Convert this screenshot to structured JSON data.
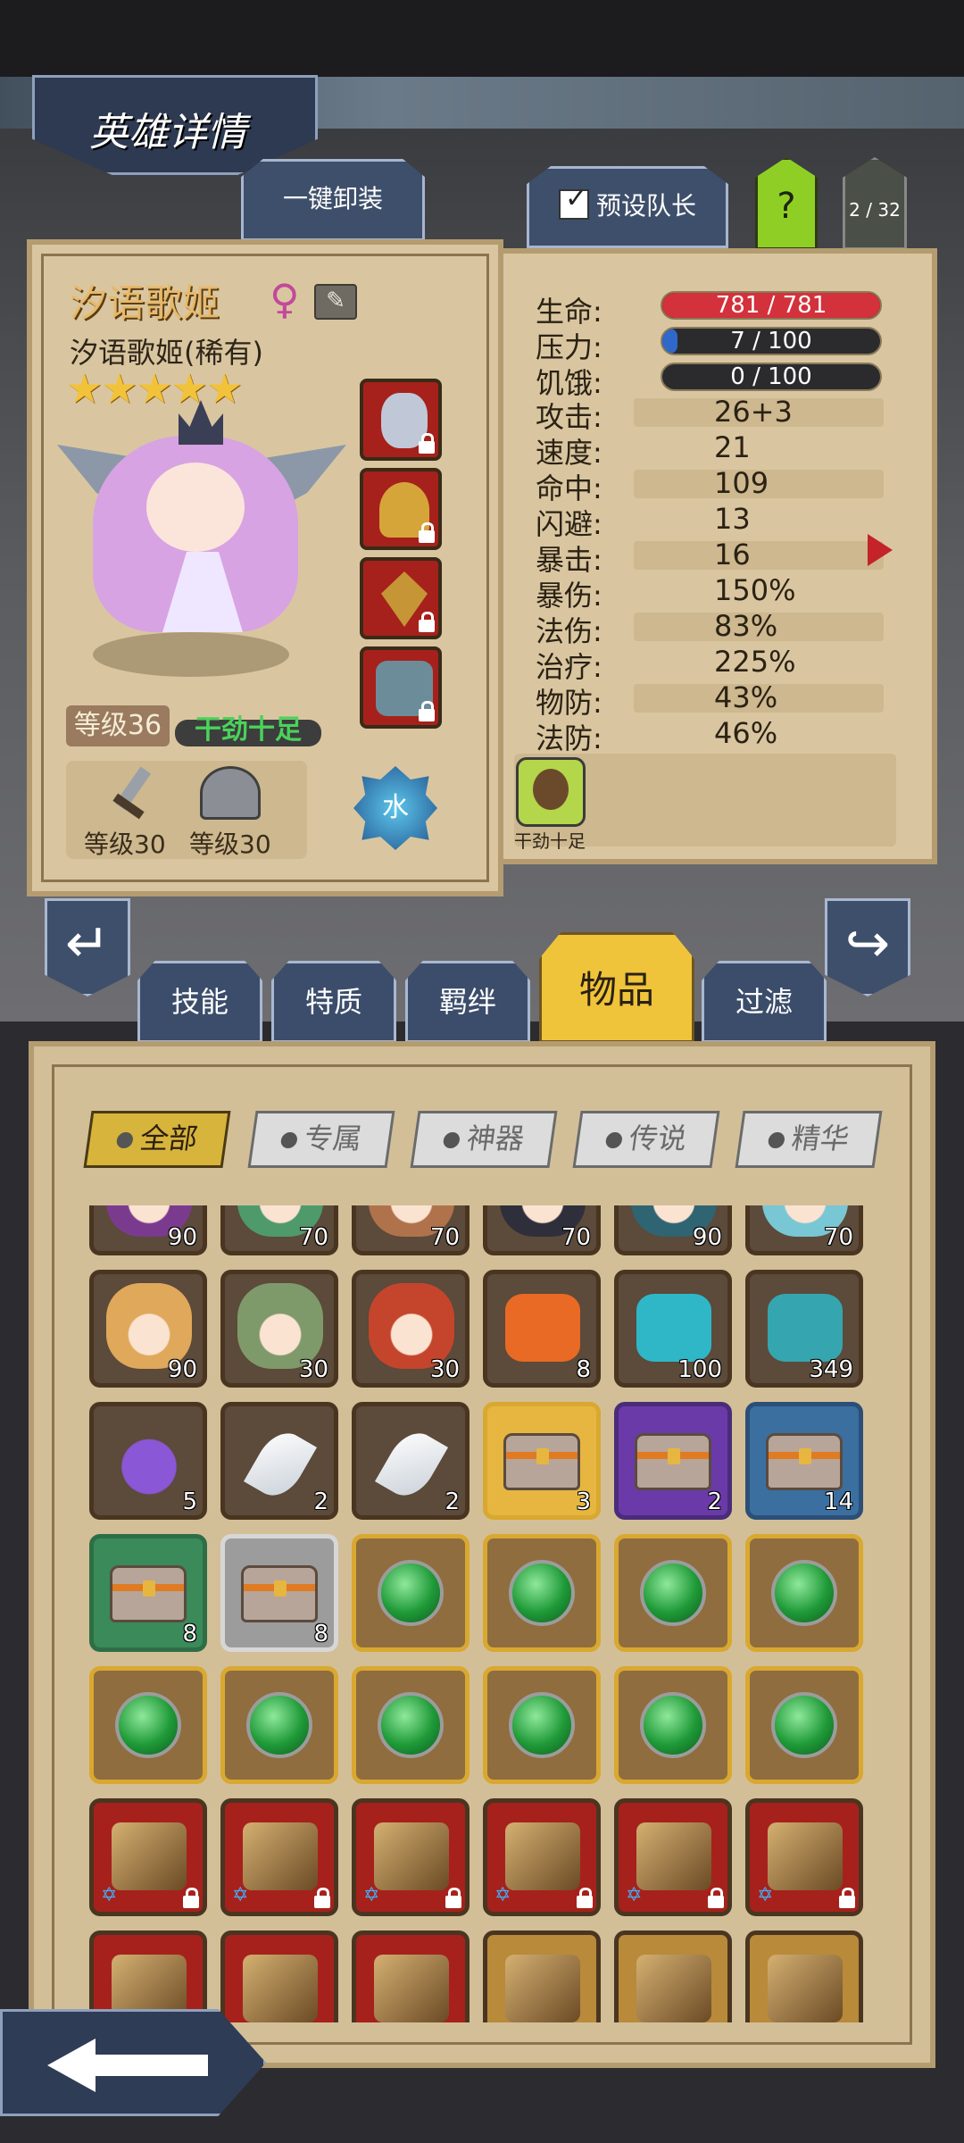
{
  "header": {
    "title": "英雄详情"
  },
  "top_buttons": {
    "unequip_all": "一键卸装",
    "preset_leader": "预设队长",
    "help": "?",
    "page_counter": "2 / 32"
  },
  "hero": {
    "name": "汐语歌姬",
    "subtitle": "汐语歌姬(稀有)",
    "stars": 5,
    "level_label": "等级36",
    "mood": "干劲十足",
    "element": "水",
    "gear": [
      {
        "icon": "sword-icon",
        "label": "等级30"
      },
      {
        "icon": "helmet-icon",
        "label": "等级30"
      }
    ],
    "status_icon_label": "干劲十足"
  },
  "stats": {
    "health": {
      "label": "生命:",
      "value": "781 / 781",
      "fraction": 1.0
    },
    "stress": {
      "label": "压力:",
      "value": "7 / 100",
      "fraction": 0.07
    },
    "hunger": {
      "label": "饥饿:",
      "value": "0 / 100",
      "fraction": 0.0
    },
    "rows": [
      {
        "label": "攻击:",
        "value": "26+3"
      },
      {
        "label": "速度:",
        "value": "21"
      },
      {
        "label": "命中:",
        "value": "109"
      },
      {
        "label": "闪避:",
        "value": "13"
      },
      {
        "label": "暴击:",
        "value": "16"
      },
      {
        "label": "暴伤:",
        "value": "150%"
      },
      {
        "label": "法伤:",
        "value": "83%"
      },
      {
        "label": "治疗:",
        "value": "225%"
      },
      {
        "label": "物防:",
        "value": "43%"
      },
      {
        "label": "法防:",
        "value": "46%"
      }
    ]
  },
  "tabs": [
    "技能",
    "特质",
    "羁绊",
    "物品",
    "过滤"
  ],
  "active_tab": "物品",
  "categories": [
    "全部",
    "专属",
    "神器",
    "传说",
    "精华"
  ],
  "active_category": "全部",
  "inventory": [
    [
      {
        "kind": "portrait",
        "count": "90",
        "color": "#7a3b8f"
      },
      {
        "kind": "portrait",
        "count": "70",
        "color": "#4f9a6a"
      },
      {
        "kind": "portrait",
        "count": "70",
        "color": "#b0724a"
      },
      {
        "kind": "portrait",
        "count": "70",
        "color": "#2e2f3b"
      },
      {
        "kind": "portrait",
        "count": "90",
        "color": "#2f6472"
      },
      {
        "kind": "portrait",
        "count": "70",
        "color": "#79c6d4"
      }
    ],
    [
      {
        "kind": "portrait",
        "count": "90",
        "color": "#e0a85a"
      },
      {
        "kind": "portrait",
        "count": "30",
        "color": "#7f9a6a"
      },
      {
        "kind": "portrait",
        "count": "30",
        "color": "#c4452c"
      },
      {
        "kind": "item",
        "count": "8",
        "color": "#e86a24"
      },
      {
        "kind": "item",
        "count": "100",
        "color": "#2fb7c8"
      },
      {
        "kind": "item",
        "count": "349",
        "color": "#35a6b0"
      }
    ],
    [
      {
        "kind": "potion",
        "count": "5",
        "color": "#8a57d6"
      },
      {
        "kind": "feather",
        "count": "2",
        "color": "#ffffff"
      },
      {
        "kind": "feather",
        "count": "2",
        "color": "#ffffff"
      },
      {
        "kind": "chest",
        "count": "3",
        "color": "#e6b640",
        "frame": "#d9a830"
      },
      {
        "kind": "chest",
        "count": "2",
        "color": "#6a3aa8",
        "frame": "#4a2c7a"
      },
      {
        "kind": "chest",
        "count": "14",
        "color": "#3b6fa0",
        "frame": "#2b4f78"
      }
    ],
    [
      {
        "kind": "chest",
        "count": "8",
        "color": "#3a8a5a",
        "frame": "#2e6e46"
      },
      {
        "kind": "chest",
        "count": "8",
        "color": "#9c9c9c",
        "frame": "#d7d7d7"
      },
      {
        "kind": "gem",
        "count": "",
        "frame": "#d9a830"
      },
      {
        "kind": "gem",
        "count": "",
        "frame": "#d9a830"
      },
      {
        "kind": "gem",
        "count": "",
        "frame": "#d9a830"
      },
      {
        "kind": "gem",
        "count": "",
        "frame": "#d9a830"
      }
    ],
    [
      {
        "kind": "gem",
        "count": "",
        "frame": "#d9a830"
      },
      {
        "kind": "gem",
        "count": "",
        "frame": "#d9a830"
      },
      {
        "kind": "gem",
        "count": "",
        "frame": "#d9a830"
      },
      {
        "kind": "gem",
        "count": "",
        "frame": "#d9a830"
      },
      {
        "kind": "gem",
        "count": "",
        "frame": "#d9a830"
      },
      {
        "kind": "gem",
        "count": "",
        "frame": "#d9a830"
      }
    ],
    [
      {
        "kind": "weapon",
        "count": "",
        "color": "#a6211b",
        "lock": true
      },
      {
        "kind": "weapon",
        "count": "",
        "color": "#a6211b",
        "lock": true
      },
      {
        "kind": "weapon",
        "count": "",
        "color": "#a6211b",
        "lock": true
      },
      {
        "kind": "weapon",
        "count": "",
        "color": "#a6211b",
        "lock": true
      },
      {
        "kind": "weapon",
        "count": "",
        "color": "#a6211b",
        "lock": true
      },
      {
        "kind": "weapon",
        "count": "",
        "color": "#a6211b",
        "lock": true
      }
    ],
    [
      {
        "kind": "weapon",
        "count": "",
        "color": "#a6211b"
      },
      {
        "kind": "weapon",
        "count": "",
        "color": "#a6211b"
      },
      {
        "kind": "weapon",
        "count": "",
        "color": "#a6211b"
      },
      {
        "kind": "weapon",
        "count": "",
        "color": "#b88a3a"
      },
      {
        "kind": "weapon",
        "count": "",
        "color": "#b88a3a"
      },
      {
        "kind": "weapon",
        "count": "",
        "color": "#b88a3a"
      }
    ]
  ],
  "colors": {
    "parchment": "#d9c6a0",
    "health_bar": "#d3313b",
    "stress_bar": "#2f68c9",
    "name_gold": "#e6b96a",
    "mood_green": "#49d35a",
    "active_tab": "#f0c43a"
  }
}
